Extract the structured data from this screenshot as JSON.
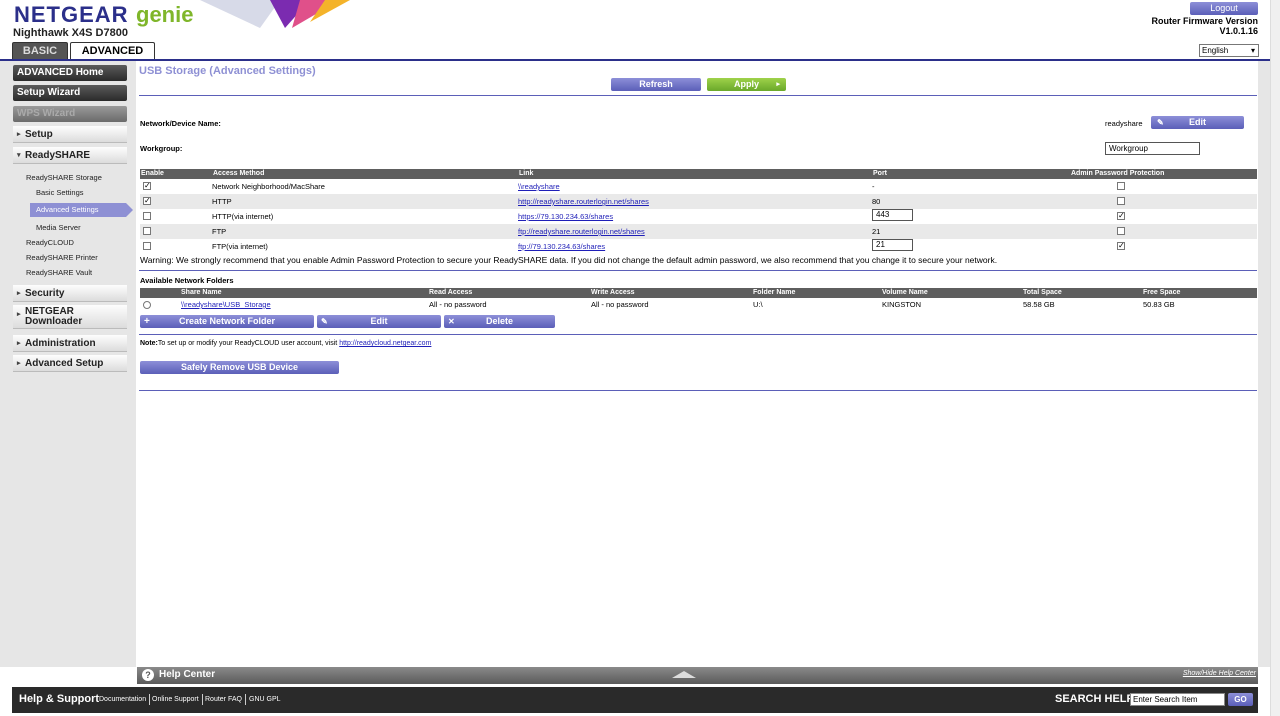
{
  "header": {
    "brand": "NETGEAR",
    "genie": "genie",
    "model": "Nighthawk X4S D7800",
    "tabs": [
      {
        "label": "BASIC"
      },
      {
        "label": "ADVANCED"
      }
    ],
    "logout": "Logout",
    "firmware_label": "Router Firmware Version",
    "firmware_version": "V1.0.1.16",
    "language": "English"
  },
  "sidebar": {
    "advanced_home": "ADVANCED Home",
    "setup_wizard": "Setup Wizard",
    "wps_wizard": "WPS Wizard",
    "setup": "Setup",
    "readyshare": "ReadySHARE",
    "readyshare_storage": "ReadySHARE Storage",
    "basic_settings": "Basic Settings",
    "advanced_settings": "Advanced Settings",
    "media_server": "Media Server",
    "readycloud": "ReadyCLOUD",
    "readyshare_printer": "ReadySHARE Printer",
    "readyshare_vault": "ReadySHARE Vault",
    "security": "Security",
    "netgear": "NETGEAR",
    "downloader": "Downloader",
    "administration": "Administration",
    "advanced_setup": "Advanced Setup"
  },
  "main": {
    "title": "USB Storage (Advanced Settings)",
    "refresh": "Refresh",
    "apply": "Apply",
    "device_name_label": "Network/Device Name:",
    "device_name_value": "readyshare",
    "edit": "Edit",
    "workgroup_label": "Workgroup:",
    "workgroup_value": "Workgroup",
    "access_headers": [
      "Enable",
      "Access Method",
      "Link",
      "Port",
      "Admin Password Protection"
    ],
    "access_rows": [
      {
        "enabled": true,
        "method": "Network Neighborhood/MacShare",
        "link": "\\\\readyshare",
        "port": "-",
        "port_editable": false,
        "protect": false
      },
      {
        "enabled": true,
        "method": "HTTP",
        "link": "http://readyshare.routerlogin.net/shares",
        "port": "80",
        "port_editable": false,
        "protect": false
      },
      {
        "enabled": false,
        "method": "HTTP(via internet)",
        "link": "https://79.130.234.63/shares",
        "port": "443",
        "port_editable": true,
        "protect": true
      },
      {
        "enabled": false,
        "method": "FTP",
        "link": "ftp://readyshare.routerlogin.net/shares",
        "port": "21",
        "port_editable": false,
        "protect": false
      },
      {
        "enabled": false,
        "method": "FTP(via internet)",
        "link": "ftp://79.130.234.63/shares",
        "port": "21",
        "port_editable": true,
        "protect": true
      }
    ],
    "warning": "Warning: We strongly recommend that you enable Admin Password Protection to secure your ReadySHARE data. If you did not change the default admin password, we also recommend that you change it to secure your network.",
    "folders_label": "Available Network Folders",
    "folder_headers": [
      "Share Name",
      "Read Access",
      "Write Access",
      "Folder Name",
      "Volume Name",
      "Total Space",
      "Free Space"
    ],
    "folder_rows": [
      {
        "share": "\\\\readyshare\\USB_Storage",
        "read": "All - no password",
        "write": "All - no password",
        "folder": "U:\\",
        "volume": "KINGSTON",
        "total": "58.58 GB",
        "free": "50.83 GB"
      }
    ],
    "create_folder": "Create Network Folder",
    "folder_edit": "Edit",
    "folder_delete": "Delete",
    "note_bold": "Note:",
    "note_text": "To set up or modify your ReadyCLOUD user account, visit ",
    "note_link": "http://readycloud.netgear.com",
    "safely_remove": "Safely Remove USB Device"
  },
  "footer": {
    "help_center": "Help Center",
    "show_hide": "Show/Hide Help Center",
    "help_support": "Help & Support",
    "links": [
      "Documentation",
      "Online Support",
      "Router FAQ",
      "GNU GPL"
    ],
    "search_label": "SEARCH HELP",
    "search_placeholder": "Enter Search Item",
    "go": "GO"
  }
}
